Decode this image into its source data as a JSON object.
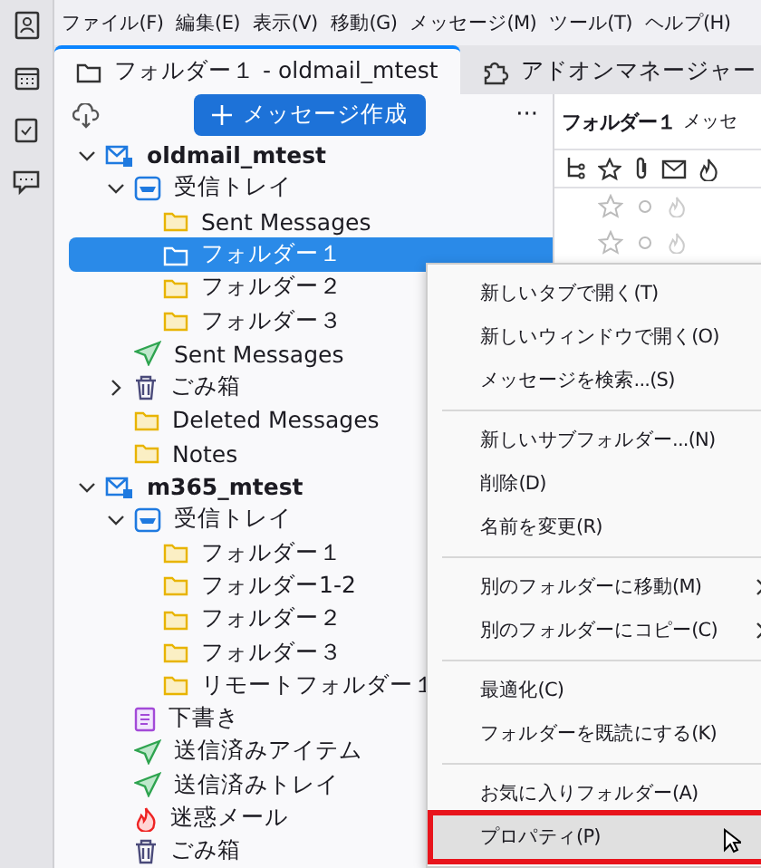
{
  "menubar": [
    "ファイル(F)",
    "編集(E)",
    "表示(V)",
    "移動(G)",
    "メッセージ(M)",
    "ツール(T)",
    "ヘルプ(H)"
  ],
  "tabs": [
    {
      "label": "フォルダー１ - oldmail_mtest",
      "kind": "folder",
      "selected": true
    },
    {
      "label": "アドオンマネージャー",
      "kind": "addons",
      "selected": false
    }
  ],
  "compose_button": "メッセージ作成",
  "more_button": "···",
  "folders": [
    {
      "label": "oldmail_mtest",
      "kind": "account",
      "expanded": true,
      "selected": false,
      "children": [
        {
          "label": "受信トレイ",
          "kind": "inbox",
          "expanded": true,
          "selected": false,
          "children": [
            {
              "label": "Sent Messages",
              "kind": "folder",
              "selected": false
            },
            {
              "label": "フォルダー１",
              "kind": "folder",
              "selected": true
            },
            {
              "label": "フォルダー２",
              "kind": "folder",
              "selected": false
            },
            {
              "label": "フォルダー３",
              "kind": "folder",
              "selected": false
            }
          ]
        },
        {
          "label": "Sent Messages",
          "kind": "sent",
          "selected": false
        },
        {
          "label": "ごみ箱",
          "kind": "trash",
          "expanded": false,
          "selected": false
        },
        {
          "label": "Deleted Messages",
          "kind": "folder",
          "selected": false
        },
        {
          "label": "Notes",
          "kind": "folder",
          "selected": false
        }
      ]
    },
    {
      "label": "m365_mtest",
      "kind": "account",
      "expanded": true,
      "selected": false,
      "children": [
        {
          "label": "受信トレイ",
          "kind": "inbox",
          "expanded": true,
          "selected": false,
          "children": [
            {
              "label": "フォルダー１",
              "kind": "folder",
              "selected": false
            },
            {
              "label": "フォルダー1-2",
              "kind": "folder",
              "selected": false
            },
            {
              "label": "フォルダー２",
              "kind": "folder",
              "selected": false
            },
            {
              "label": "フォルダー３",
              "kind": "folder",
              "selected": false
            },
            {
              "label": "リモートフォルダー１",
              "kind": "folder",
              "selected": false
            }
          ]
        },
        {
          "label": "下書き",
          "kind": "drafts",
          "selected": false
        },
        {
          "label": "送信済みアイテム",
          "kind": "sent",
          "selected": false
        },
        {
          "label": "送信済みトレイ",
          "kind": "sent",
          "selected": false
        },
        {
          "label": "迷惑メール",
          "kind": "junk",
          "selected": false
        },
        {
          "label": "ごみ箱",
          "kind": "trash",
          "selected": false
        }
      ]
    }
  ],
  "message_pane": {
    "title": "フォルダー１",
    "title_2": "メッセ"
  },
  "context_menu": [
    [
      {
        "label": "新しいタブで開く(T)",
        "submenu": false,
        "selected": false
      },
      {
        "label": "新しいウィンドウで開く(O)",
        "submenu": false,
        "selected": false
      },
      {
        "label": "メッセージを検索...(S)",
        "submenu": false,
        "selected": false
      }
    ],
    [
      {
        "label": "新しいサブフォルダー...(N)",
        "submenu": false,
        "selected": false
      },
      {
        "label": "削除(D)",
        "submenu": false,
        "selected": false
      },
      {
        "label": "名前を変更(R)",
        "submenu": false,
        "selected": false
      }
    ],
    [
      {
        "label": "別のフォルダーに移動(M)",
        "submenu": true,
        "selected": false
      },
      {
        "label": "別のフォルダーにコピー(C)",
        "submenu": true,
        "selected": false
      }
    ],
    [
      {
        "label": "最適化(C)",
        "submenu": false,
        "selected": false
      },
      {
        "label": "フォルダーを既読にする(K)",
        "submenu": false,
        "selected": false
      }
    ],
    [
      {
        "label": "お気に入りフォルダー(A)",
        "submenu": false,
        "selected": false
      },
      {
        "label": "プロパティ(P)",
        "submenu": false,
        "selected": true
      }
    ]
  ]
}
